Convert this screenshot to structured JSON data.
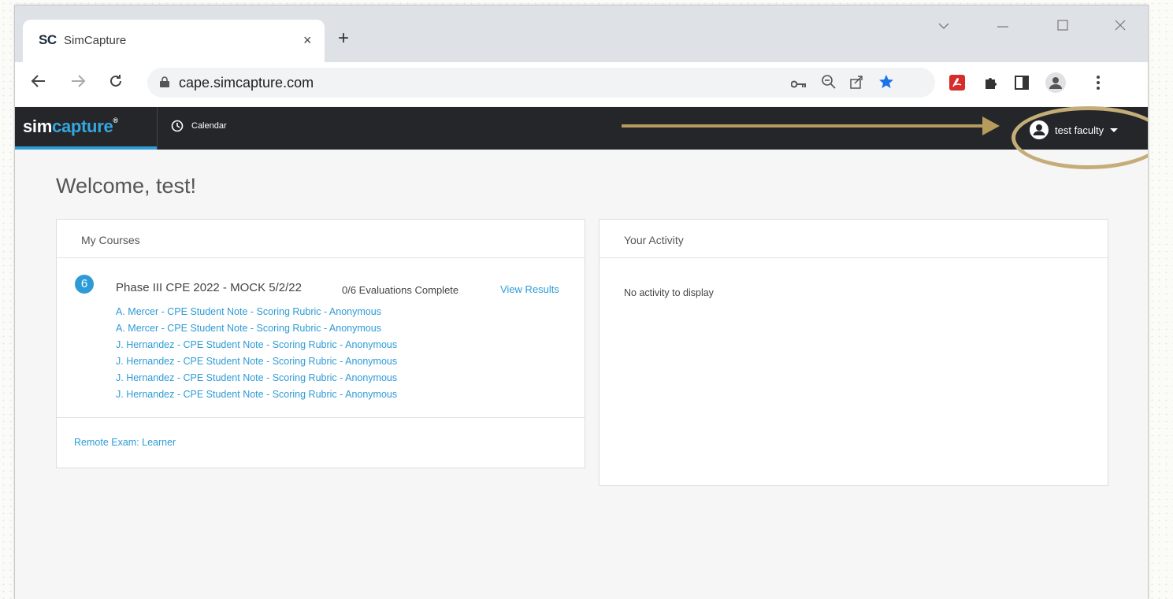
{
  "browser": {
    "tab_favicon": "SC",
    "tab_title": "SimCapture",
    "tab_close": "×",
    "new_tab": "+",
    "url": "cape.simcapture.com"
  },
  "app": {
    "logo_sim": "sim",
    "logo_capture": "capture",
    "logo_reg": "®",
    "nav_calendar": "Calendar",
    "user_name": "test faculty"
  },
  "main": {
    "welcome": "Welcome, test!",
    "courses": {
      "heading": "My Courses",
      "badge_count": "6",
      "course_title": "Phase III CPE 2022 - MOCK 5/2/22",
      "status": "0/6 Evaluations Complete",
      "view_results": "View Results",
      "rubrics": [
        "A. Mercer - CPE Student Note - Scoring Rubric - Anonymous",
        "A. Mercer - CPE Student Note - Scoring Rubric - Anonymous",
        "J. Hernandez - CPE Student Note - Scoring Rubric - Anonymous",
        "J. Hernandez - CPE Student Note - Scoring Rubric - Anonymous",
        "J. Hernandez - CPE Student Note - Scoring Rubric - Anonymous",
        "J. Hernandez - CPE Student Note - Scoring Rubric - Anonymous"
      ],
      "remote_exam": "Remote Exam: Learner"
    },
    "activity": {
      "heading": "Your Activity",
      "empty": "No activity to display"
    }
  },
  "colors": {
    "accent": "#2d9bd6",
    "header_bg": "#252629",
    "annotation": "#b59b5c"
  }
}
